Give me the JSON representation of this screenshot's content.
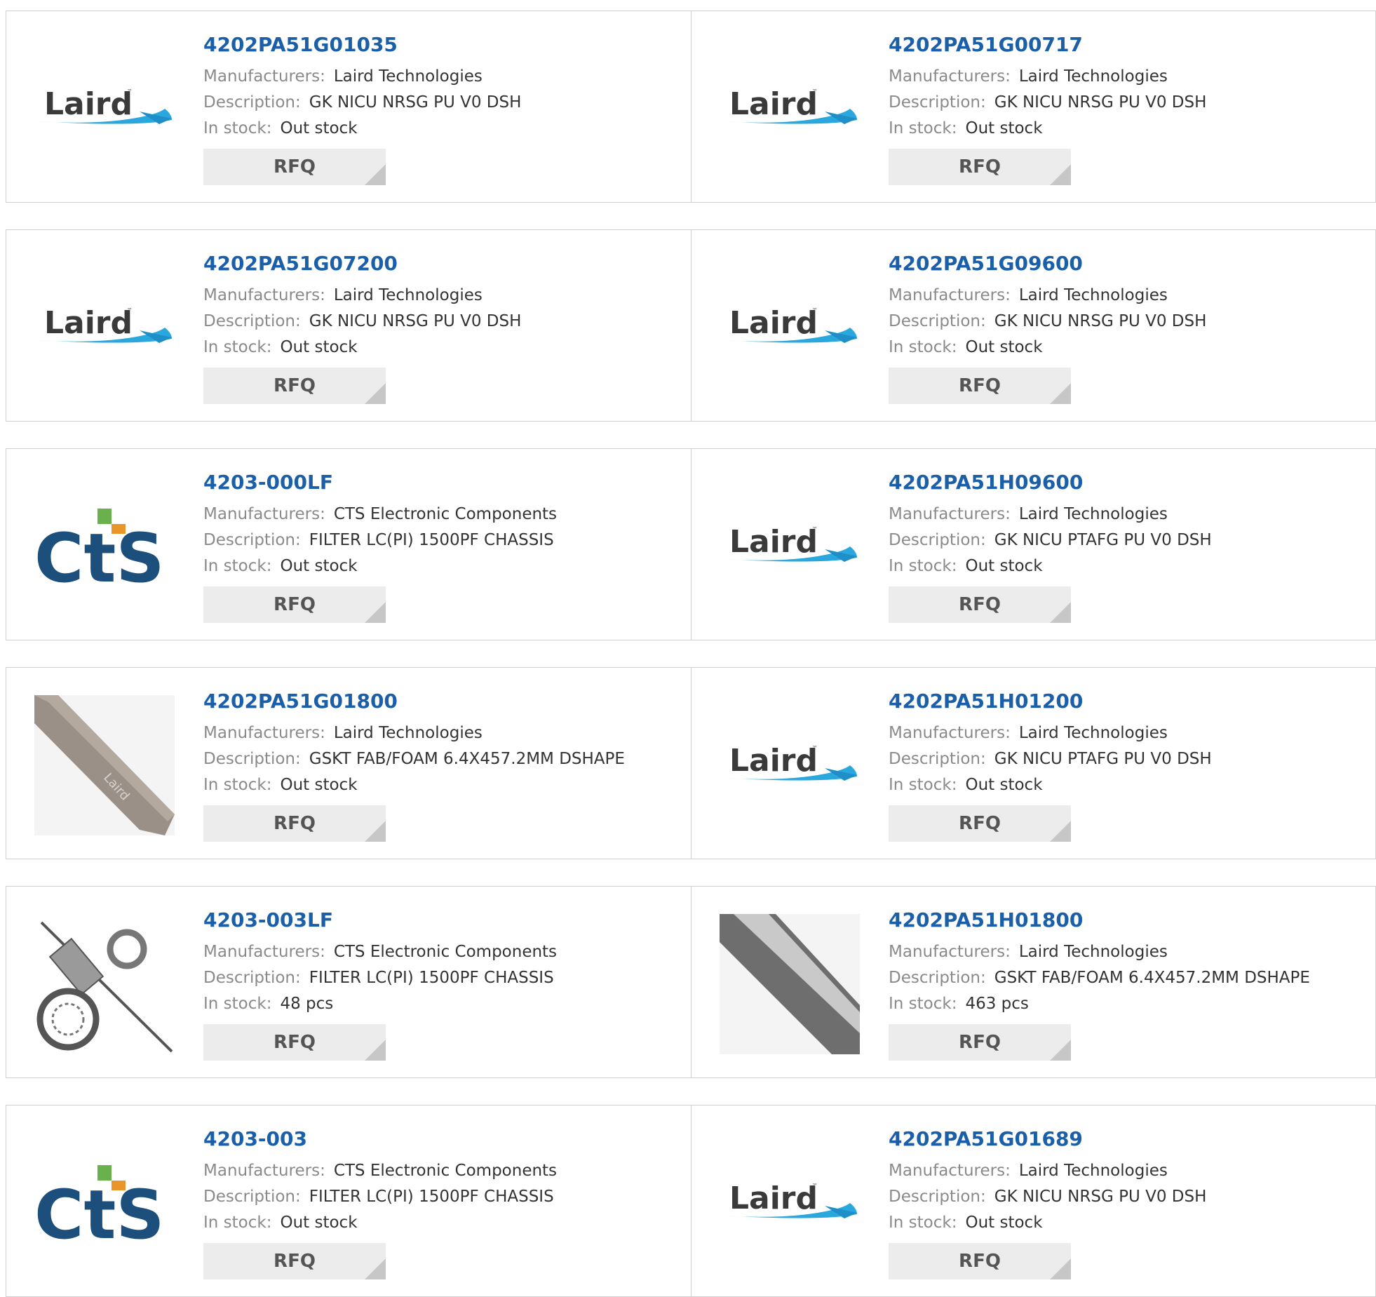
{
  "labels": {
    "manufacturers": "Manufacturers:",
    "description": "Description:",
    "in_stock": "In stock:",
    "rfq": "RFQ"
  },
  "colors": {
    "part_link": "#1a5fa8",
    "label": "#8a8a8a",
    "value": "#333333",
    "card_border": "#cfcfcf",
    "rfq_bg": "#ececec"
  },
  "products": [
    {
      "part": "4202PA51G01035",
      "manufacturer": "Laird Technologies",
      "description": "GK NICU NRSG PU V0 DSH",
      "stock": "Out stock",
      "image": "laird-logo",
      "brand_text": "Laird"
    },
    {
      "part": "4202PA51G00717",
      "manufacturer": "Laird Technologies",
      "description": "GK NICU NRSG PU V0 DSH",
      "stock": "Out stock",
      "image": "laird-logo",
      "brand_text": "Laird"
    },
    {
      "part": "4202PA51G07200",
      "manufacturer": "Laird Technologies",
      "description": "GK NICU NRSG PU V0 DSH",
      "stock": "Out stock",
      "image": "laird-logo",
      "brand_text": "Laird"
    },
    {
      "part": "4202PA51G09600",
      "manufacturer": "Laird Technologies",
      "description": "GK NICU NRSG PU V0 DSH",
      "stock": "Out stock",
      "image": "laird-logo",
      "brand_text": "Laird"
    },
    {
      "part": "4203-000LF",
      "manufacturer": "CTS Electronic Components",
      "description": "FILTER LC(PI) 1500PF CHASSIS",
      "stock": "Out stock",
      "image": "cts-logo",
      "brand_text": "CTS"
    },
    {
      "part": "4202PA51H09600",
      "manufacturer": "Laird Technologies",
      "description": "GK NICU PTAFG PU V0 DSH",
      "stock": "Out stock",
      "image": "laird-logo",
      "brand_text": "Laird"
    },
    {
      "part": "4202PA51G01800",
      "manufacturer": "Laird Technologies",
      "description": "GSKT FAB/FOAM 6.4X457.2MM DSHAPE",
      "stock": "Out stock",
      "image": "gasket-strip-photo",
      "brand_text": "Laird"
    },
    {
      "part": "4202PA51H01200",
      "manufacturer": "Laird Technologies",
      "description": "GK NICU PTAFG PU V0 DSH",
      "stock": "Out stock",
      "image": "laird-logo",
      "brand_text": "Laird"
    },
    {
      "part": "4203-003LF",
      "manufacturer": "CTS Electronic Components",
      "description": "FILTER LC(PI) 1500PF CHASSIS",
      "stock": "48 pcs",
      "image": "filter-hardware-photo",
      "brand_text": ""
    },
    {
      "part": "4202PA51H01800",
      "manufacturer": "Laird Technologies",
      "description": "GSKT FAB/FOAM 6.4X457.2MM DSHAPE",
      "stock": "463 pcs",
      "image": "gasket-bar-photo",
      "brand_text": ""
    },
    {
      "part": "4203-003",
      "manufacturer": "CTS Electronic Components",
      "description": "FILTER LC(PI) 1500PF CHASSIS",
      "stock": "Out stock",
      "image": "cts-logo",
      "brand_text": "CTS"
    },
    {
      "part": "4202PA51G01689",
      "manufacturer": "Laird Technologies",
      "description": "GK NICU NRSG PU V0 DSH",
      "stock": "Out stock",
      "image": "laird-logo",
      "brand_text": "Laird"
    }
  ]
}
